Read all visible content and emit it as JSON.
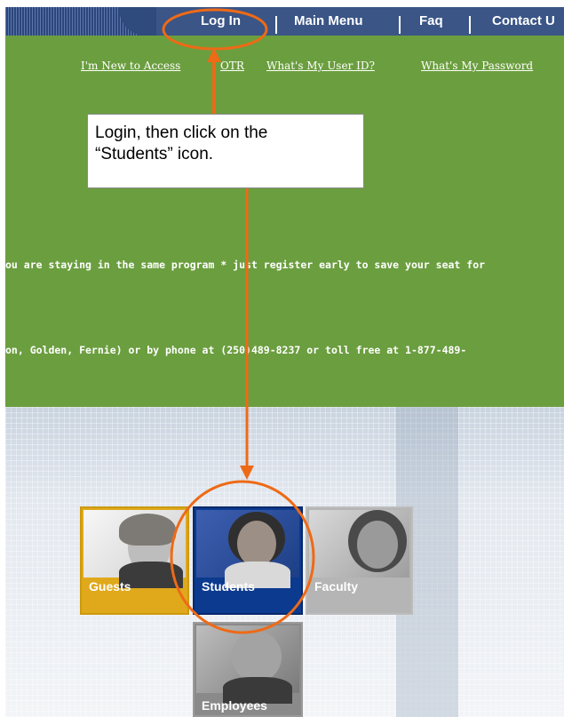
{
  "nav": {
    "items": [
      {
        "label": "Log In"
      },
      {
        "label": "Main Menu"
      },
      {
        "label": "Faq"
      },
      {
        "label": "Contact U"
      }
    ]
  },
  "sublinks": [
    "I'm New to Access",
    "OTR",
    "What's My User ID?",
    "What's My Password"
  ],
  "notices": [
    "ou are staying in the same program * just register early to save your seat for",
    "on, Golden, Fernie) or by phone at (250)489-8237 or toll free at 1-877-489-"
  ],
  "callout": {
    "text": "Login, then click on the “Students” icon."
  },
  "tiles": [
    {
      "label": "Guests",
      "color": "#e0a91c"
    },
    {
      "label": "Students",
      "color": "#0b3a8f"
    },
    {
      "label": "Faculty",
      "color": "#b5b5b5"
    },
    {
      "label": "Employees",
      "color": "#8a8a8a"
    }
  ],
  "annotation_color": "#ee6a16"
}
